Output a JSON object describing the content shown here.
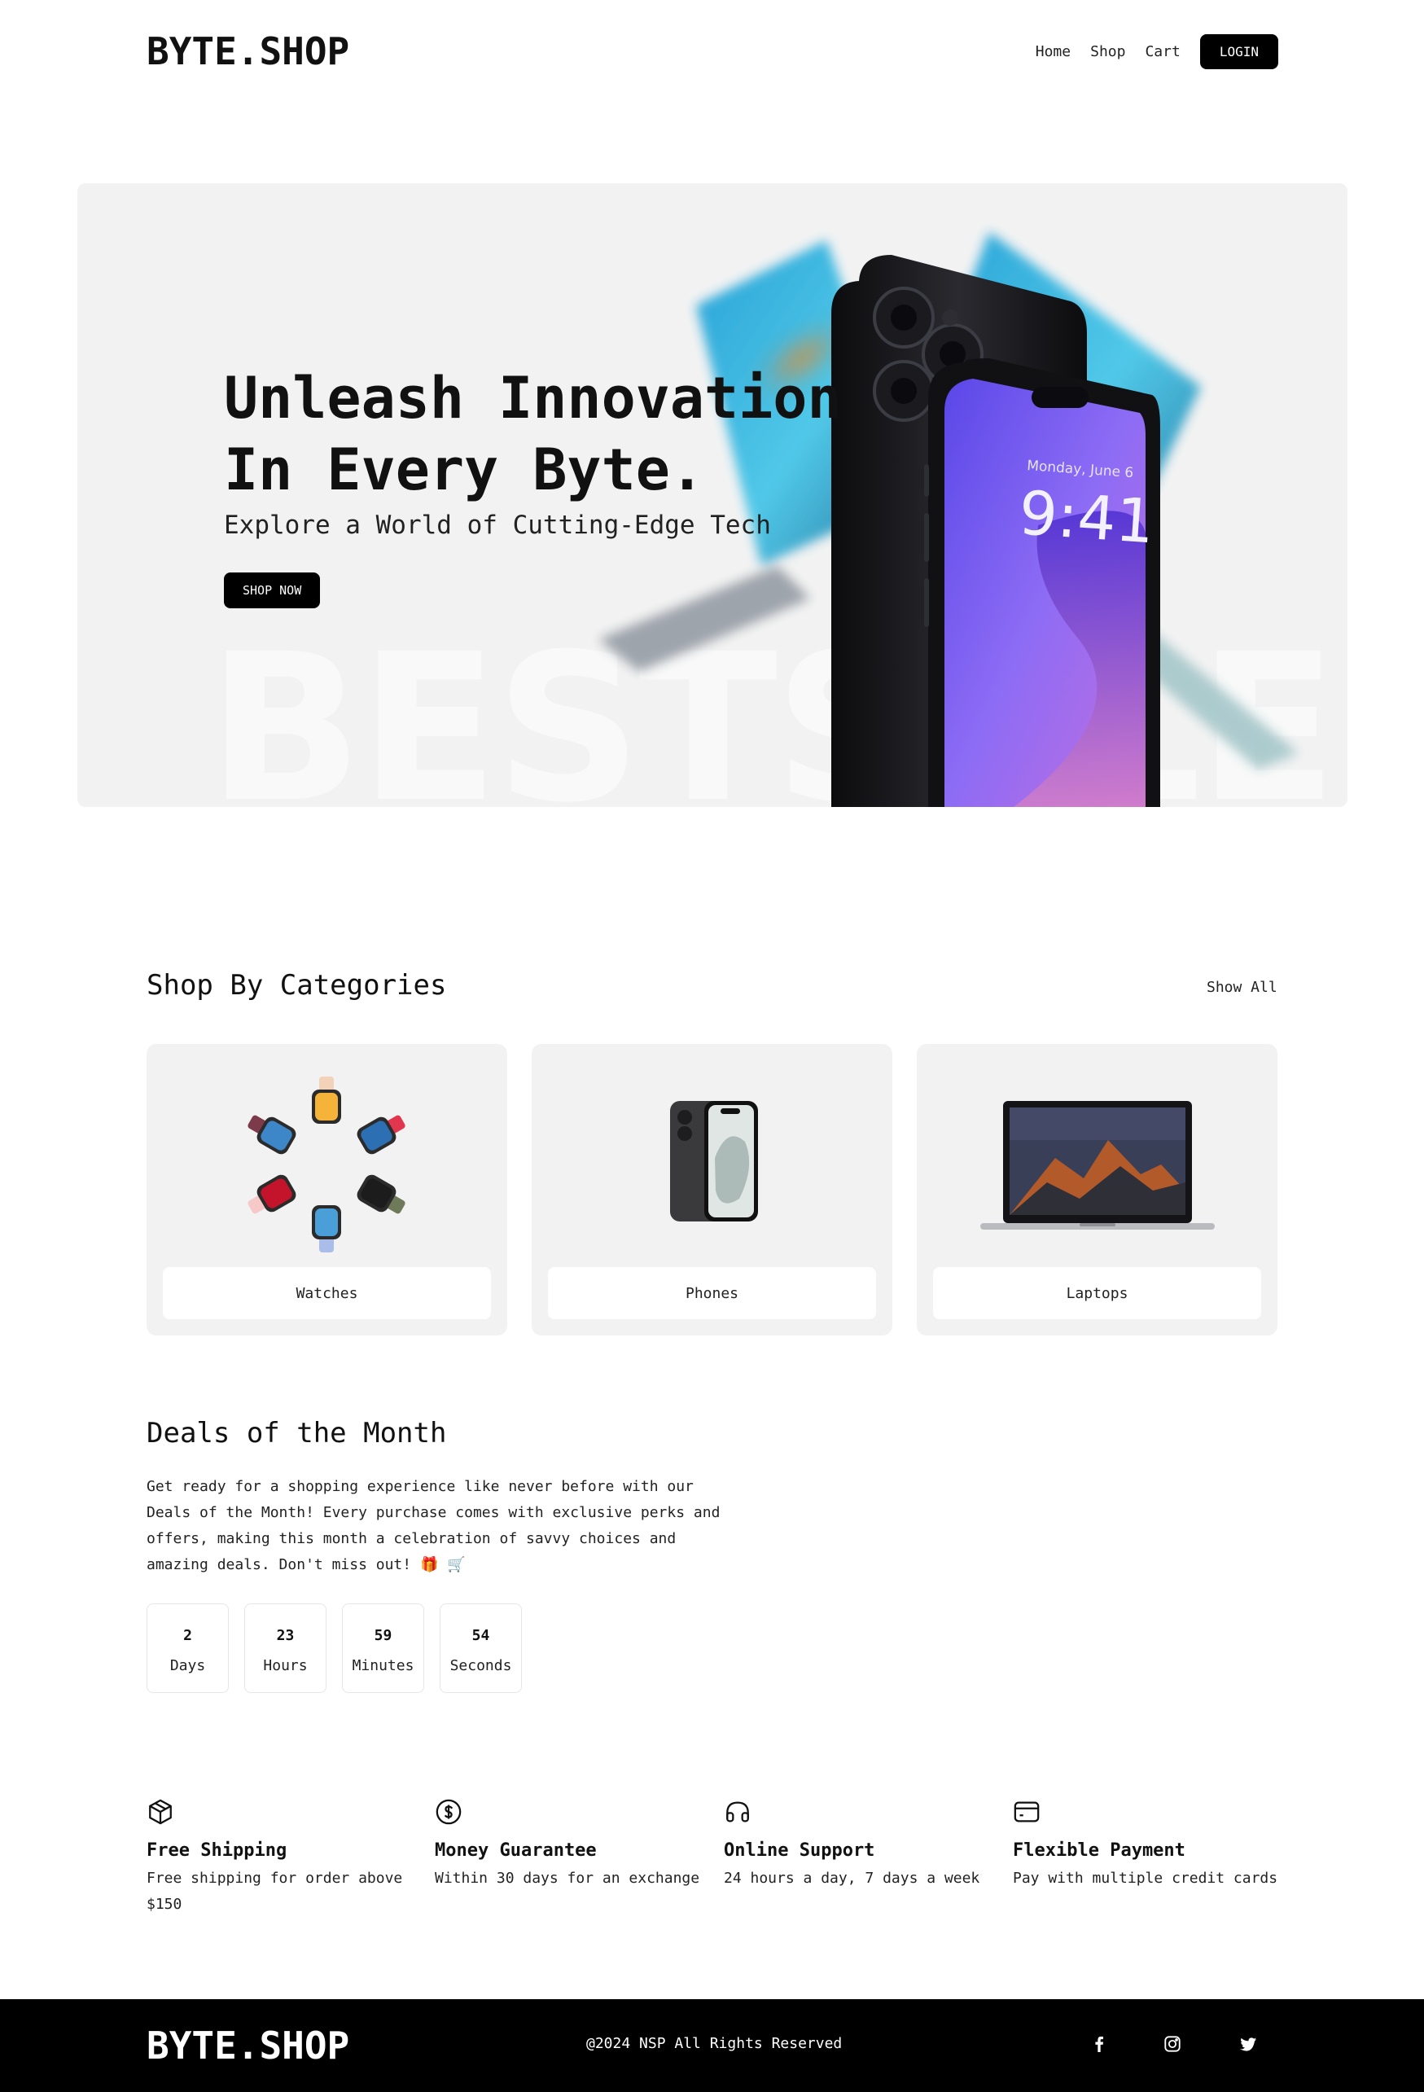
{
  "brand": {
    "logo": "BYTE.SHOP"
  },
  "nav": {
    "home": "Home",
    "shop": "Shop",
    "cart": "Cart",
    "login": "LOGIN"
  },
  "hero": {
    "title_line1": "Unleash Innovation",
    "title_line2": "In Every Byte.",
    "subtitle": "Explore a World of Cutting-Edge Tech",
    "cta": "SHOP NOW",
    "watermark": "BESTSALE",
    "phone_date": "Monday, June 6",
    "phone_time": "9:41"
  },
  "categories": {
    "title": "Shop By Categories",
    "show_all": "Show All",
    "items": [
      {
        "label": "Watches",
        "image": "watches-image"
      },
      {
        "label": "Phones",
        "image": "phone-image"
      },
      {
        "label": "Laptops",
        "image": "laptop-image"
      }
    ]
  },
  "deals": {
    "title": "Deals of the Month",
    "description": "Get ready for a shopping experience like never before with our Deals of the Month! Every purchase comes with exclusive perks and offers, making this month a celebration of savvy choices and amazing deals. Don't miss out! 🎁 🛒",
    "countdown": [
      {
        "value": "2",
        "unit": "Days"
      },
      {
        "value": "23",
        "unit": "Hours"
      },
      {
        "value": "59",
        "unit": "Minutes"
      },
      {
        "value": "54",
        "unit": "Seconds"
      }
    ]
  },
  "features": [
    {
      "icon": "box-icon",
      "title": "Free Shipping",
      "desc": "Free shipping for order above $150"
    },
    {
      "icon": "dollar-icon",
      "title": "Money Guarantee",
      "desc": "Within 30 days for an exchange"
    },
    {
      "icon": "headphones-icon",
      "title": "Online Support",
      "desc": "24 hours a day, 7 days a week"
    },
    {
      "icon": "credit-card-icon",
      "title": "Flexible Payment",
      "desc": "Pay with multiple credit cards"
    }
  ],
  "footer": {
    "logo": "BYTE.SHOP",
    "copyright": "@2024 NSP All Rights Reserved",
    "social": [
      "facebook-icon",
      "instagram-icon",
      "twitter-icon"
    ]
  },
  "colors": {
    "primary": "#000000",
    "panel": "#f2f2f2",
    "text": "#111111",
    "phone_screen": "#7b5cf0"
  }
}
